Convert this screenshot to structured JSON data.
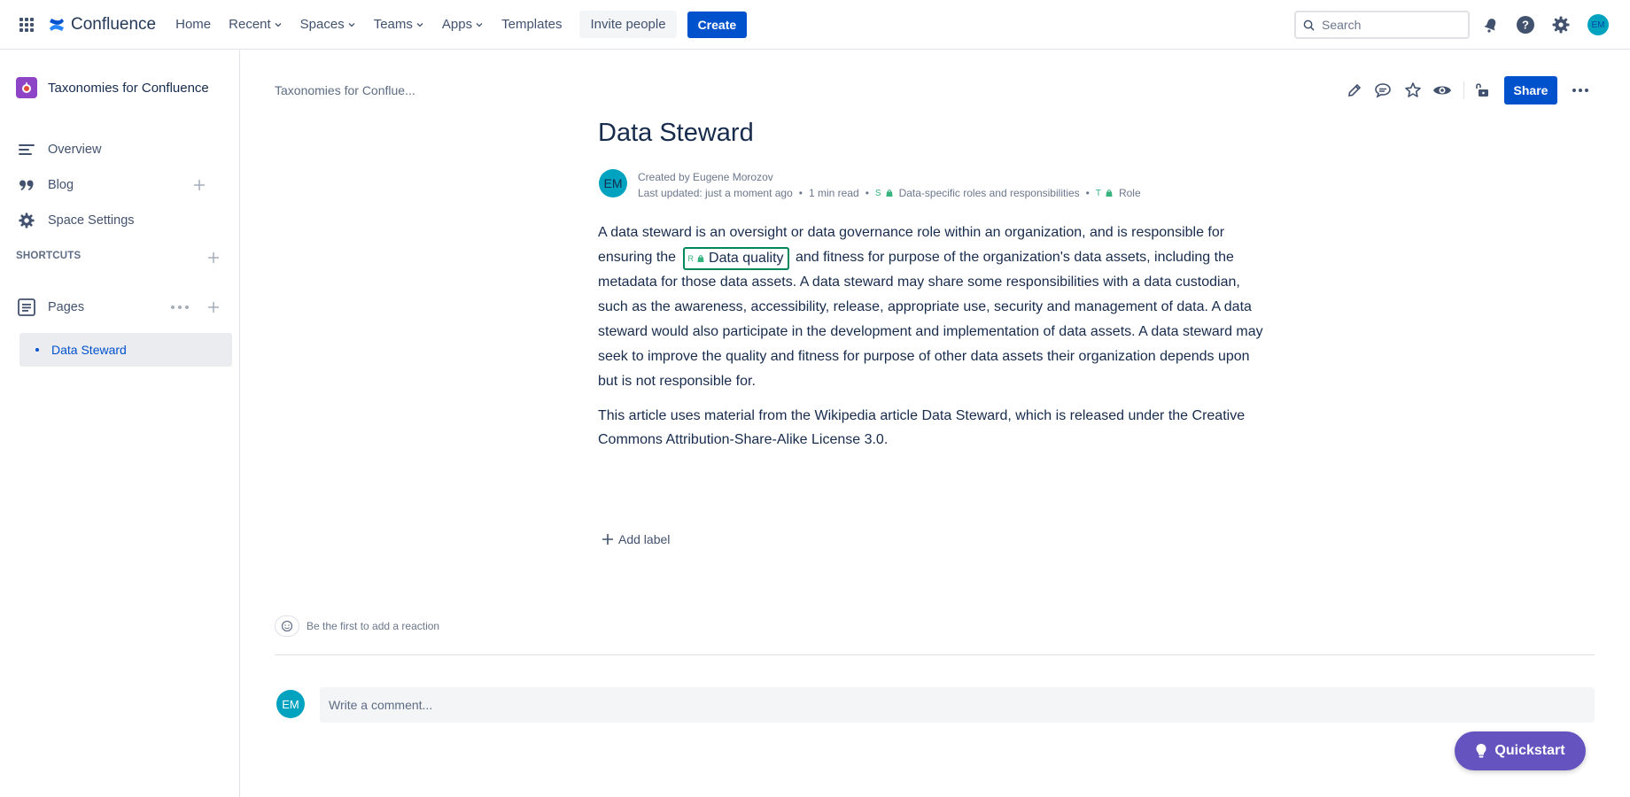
{
  "topnav": {
    "brand": "Confluence",
    "items": [
      {
        "label": "Home",
        "dropdown": false
      },
      {
        "label": "Recent",
        "dropdown": true
      },
      {
        "label": "Spaces",
        "dropdown": true
      },
      {
        "label": "Teams",
        "dropdown": true
      },
      {
        "label": "Apps",
        "dropdown": true
      },
      {
        "label": "Templates",
        "dropdown": false
      }
    ],
    "invite_label": "Invite people",
    "create_label": "Create",
    "search_placeholder": "Search",
    "user_initials": "EM"
  },
  "sidebar": {
    "space_name": "Taxonomies for Confluence",
    "items": [
      {
        "label": "Overview",
        "icon": "overview-icon"
      },
      {
        "label": "Blog",
        "icon": "quote-icon"
      },
      {
        "label": "Space Settings",
        "icon": "gear-icon"
      }
    ],
    "shortcuts_label": "SHORTCUTS",
    "pages_label": "Pages",
    "page_tree": [
      {
        "label": "Data Steward",
        "selected": true
      }
    ]
  },
  "page": {
    "breadcrumb": "Taxonomies for Conflue...",
    "share_label": "Share",
    "title": "Data Steward",
    "author_initials": "EM",
    "created_by": "Created by Eugene Morozov",
    "last_updated": "Last updated: just a moment ago",
    "read_time": "1 min read",
    "tag1_prefix": "S",
    "tag1_label": "Data-specific roles and responsibilities",
    "tag2_prefix": "T",
    "tag2_label": "Role",
    "para1_before": "A data steward is an oversight or data governance role within an organization, and is responsible for ensuring the",
    "inline_tag_prefix": "R",
    "inline_tag_label": "Data quality",
    "para1_after": "and fitness for purpose of the organization's data assets, including the metadata for those data assets. A data steward may share some responsibilities with a data custodian, such as the awareness, accessibility, release, appropriate use, security and management of data. A data steward would also participate in the development and implementation of data assets. A data steward may seek to improve the quality and fitness for purpose of other data assets their organization depends upon but is not responsible for.",
    "para2": "This article uses material from the Wikipedia article Data Steward, which is released under the Creative Commons Attribution-Share-Alike License 3.0.",
    "add_label": "Add label",
    "reaction_text": "Be the first to add a reaction",
    "comment_placeholder": "Write a comment...",
    "commenter_initials": "EM"
  },
  "quickstart_label": "Quickstart",
  "colors": {
    "primary": "#0052cc",
    "tag_green": "#00875a",
    "quickstart": "#6554c0",
    "avatar": "#00a3bf"
  }
}
